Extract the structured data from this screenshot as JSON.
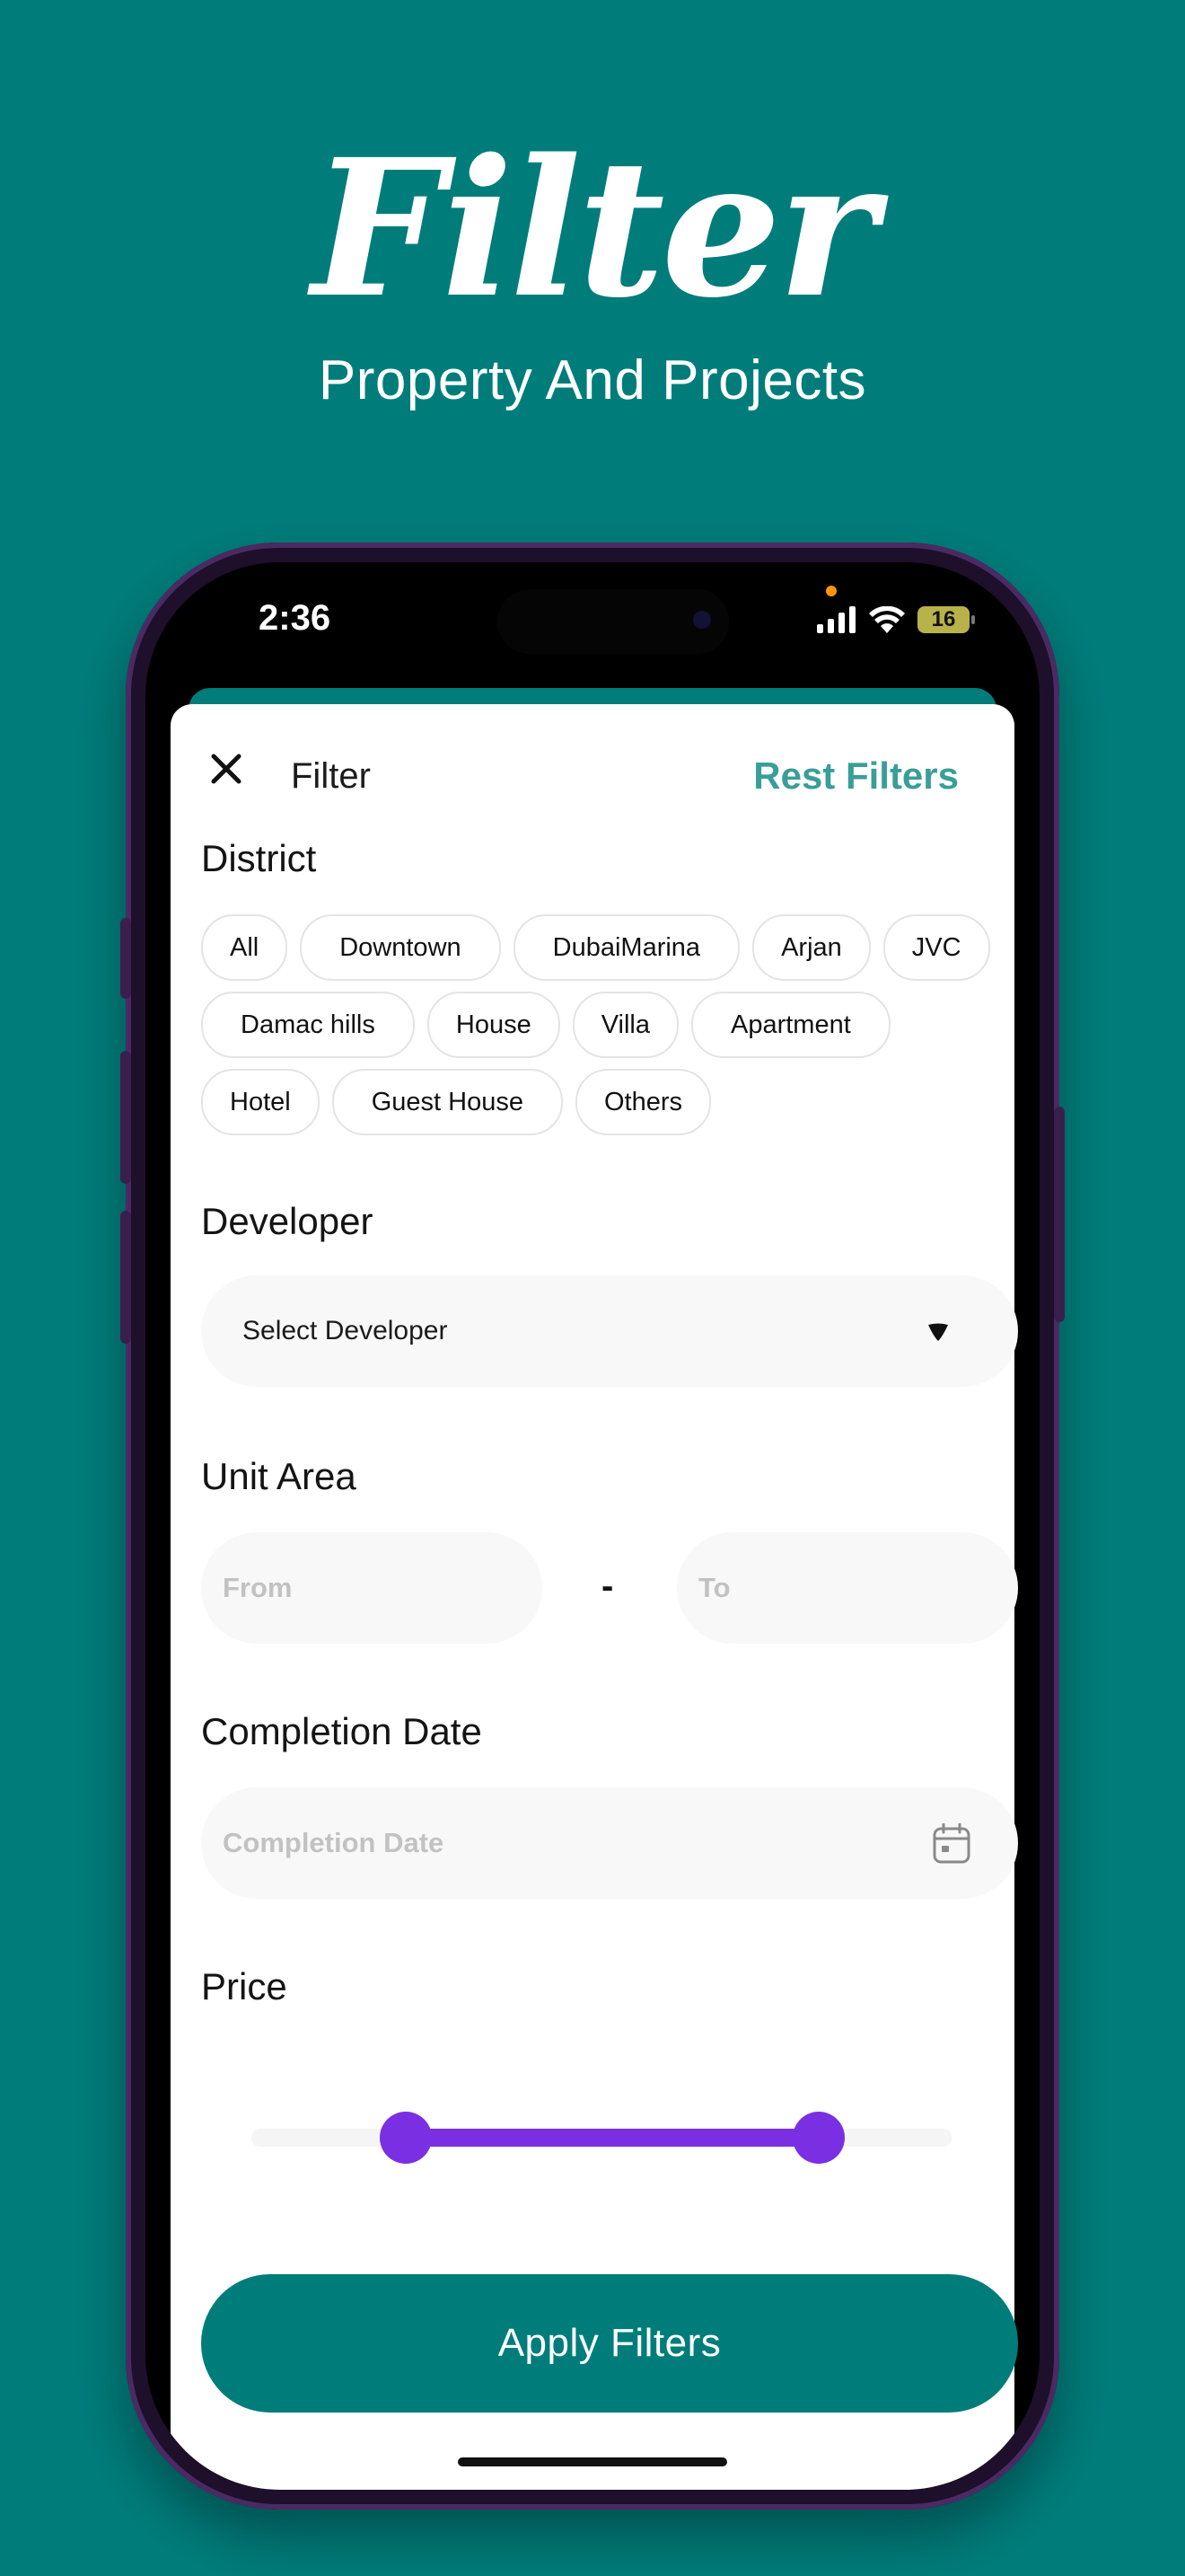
{
  "hero": {
    "title": "Filter",
    "subtitle": "Property And Projects"
  },
  "status_bar": {
    "time": "2:36",
    "battery": "16"
  },
  "header": {
    "title": "Filter",
    "reset_label": "Rest Filters"
  },
  "district": {
    "title": "District",
    "rows": [
      [
        "All",
        "Downtown",
        "DubaiMarina",
        "Arjan",
        "JVC"
      ],
      [
        "Damac hills",
        "House",
        "Villa",
        "Apartment"
      ],
      [
        "Hotel",
        "Guest House",
        "Others"
      ]
    ]
  },
  "developer": {
    "title": "Developer",
    "placeholder": "Select Developer"
  },
  "unit_area": {
    "title": "Unit Area",
    "from_placeholder": "From",
    "to_placeholder": "To",
    "separator": "-"
  },
  "completion": {
    "title": "Completion Date",
    "placeholder": "Completion Date"
  },
  "price": {
    "title": "Price",
    "range_min_fraction": 0.22,
    "range_max_fraction": 0.81
  },
  "apply": {
    "label": "Apply Filters"
  },
  "colors": {
    "brand": "#007d7b",
    "reset": "#3a9e98",
    "slider": "#7b2fe3"
  },
  "icons": [
    "close-icon",
    "dropdown-caret-icon",
    "calendar-icon",
    "signal-icon",
    "wifi-icon",
    "battery-icon"
  ]
}
